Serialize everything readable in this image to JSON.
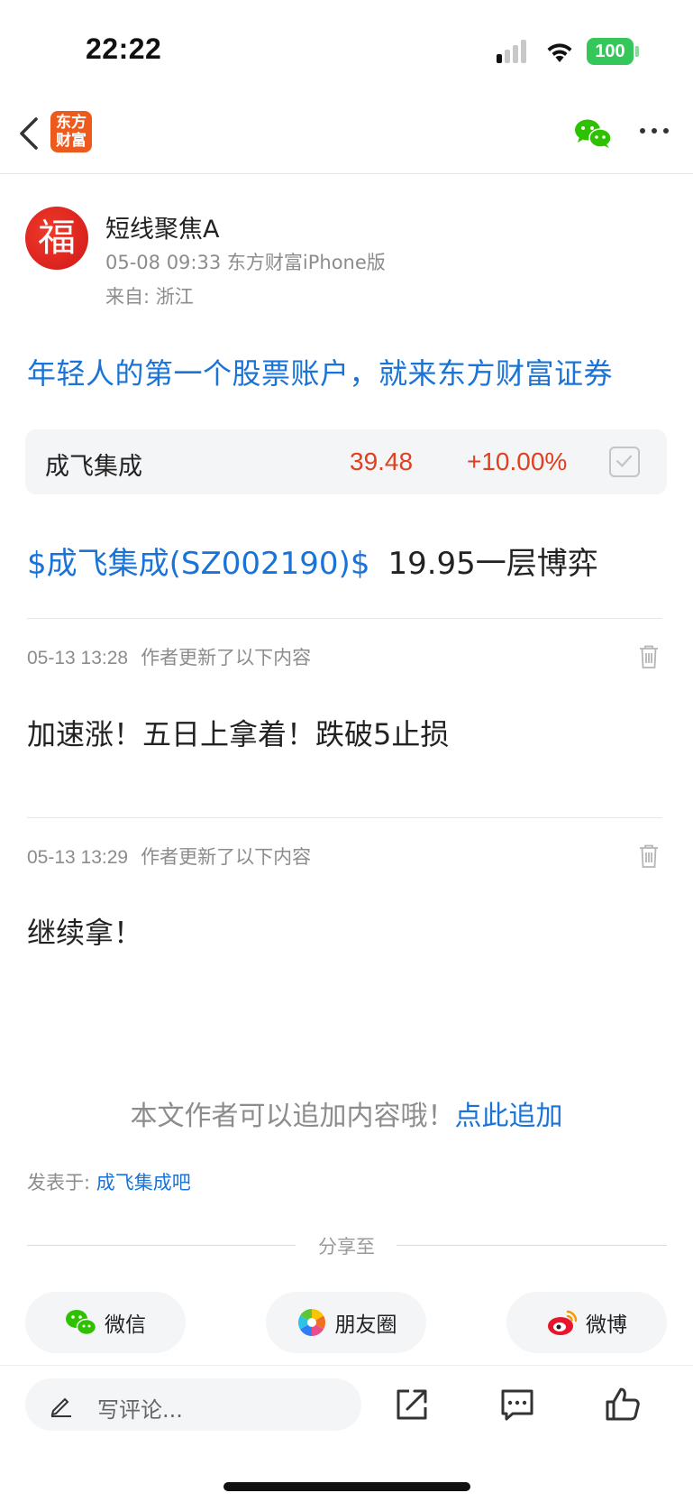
{
  "status_bar": {
    "time": "22:22",
    "battery": "100"
  },
  "nav": {
    "logo_text_line1": "东方",
    "logo_text_line2": "财富"
  },
  "author": {
    "avatar_char": "福",
    "name": "短线聚焦A",
    "meta": "05-08 09:33 东方财富iPhone版",
    "location": "来自: 浙江"
  },
  "promo": "年轻人的第一个股票账户，就来东方财富证券",
  "stock_card": {
    "name": "成飞集成",
    "price": "39.48",
    "change": "+10.00%",
    "price_color": "#e0401f"
  },
  "post": {
    "stock_link": "$成飞集成(SZ002190)$",
    "text": "19.95一层博弈"
  },
  "updates": [
    {
      "timestamp": "05-13 13:28",
      "label": "作者更新了以下内容",
      "body": "加速涨！五日上拿着！跌破5止损"
    },
    {
      "timestamp": "05-13 13:29",
      "label": "作者更新了以下内容",
      "body": "继续拿！"
    }
  ],
  "append": {
    "prefix": "本文作者可以追加内容哦！",
    "link": "点此追加"
  },
  "posted_in": {
    "label": "发表于: ",
    "bar": "成飞集成吧"
  },
  "share": {
    "label": "分享至",
    "buttons": [
      {
        "label": "微信",
        "icon": "wechat-icon"
      },
      {
        "label": "朋友圈",
        "icon": "moments-icon"
      },
      {
        "label": "微博",
        "icon": "weibo-icon"
      }
    ]
  },
  "bottom_bar": {
    "comment_placeholder": "写评论..."
  },
  "colors": {
    "link": "#1a73d6",
    "up": "#e0401f",
    "wechat": "#2dc100"
  }
}
